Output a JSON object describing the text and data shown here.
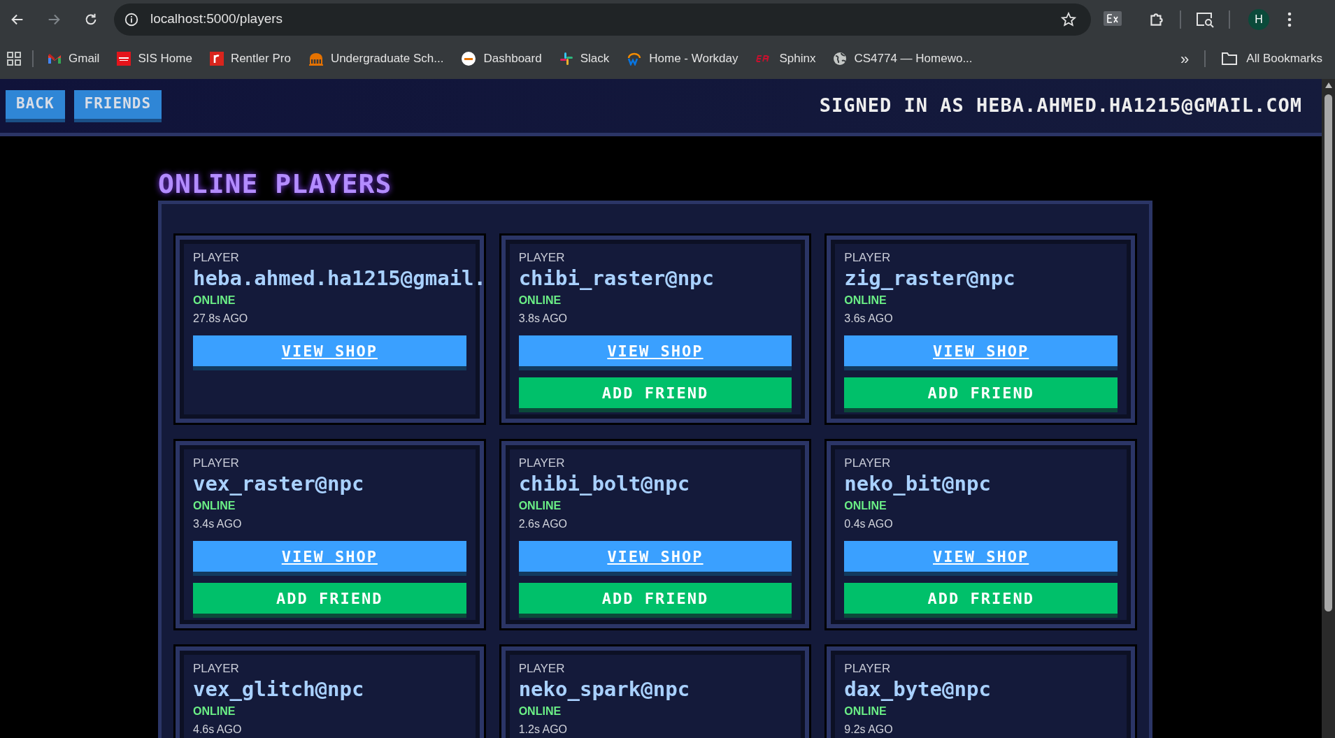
{
  "browser": {
    "url": "localhost:5000/players",
    "profile_initial": "H",
    "bookmarks": [
      {
        "label": "Gmail",
        "kind": "gmail"
      },
      {
        "label": "SIS Home",
        "kind": "oracle"
      },
      {
        "label": "Rentler Pro",
        "kind": "rentler"
      },
      {
        "label": "Undergraduate Sch...",
        "kind": "building"
      },
      {
        "label": "Dashboard",
        "kind": "uva"
      },
      {
        "label": "Slack",
        "kind": "slack"
      },
      {
        "label": "Home - Workday",
        "kind": "workday"
      },
      {
        "label": "Sphinx",
        "kind": "epic"
      },
      {
        "label": "CS4774 — Homewo...",
        "kind": "globe"
      }
    ],
    "more_bookmarks": "»",
    "all_bookmarks": "All Bookmarks"
  },
  "header": {
    "buttons": [
      "BACK",
      "FRIENDS"
    ],
    "signed_in": "SIGNED IN AS HEBA.AHMED.HA1215@GMAIL.COM"
  },
  "title": "ONLINE PLAYERS",
  "players": [
    {
      "label": "PLAYER",
      "name": "heba.ahmed.ha1215@gmail.",
      "status": "ONLINE",
      "ago": "27.8s AGO",
      "view_shop": "VIEW SHOP"
    },
    {
      "label": "PLAYER",
      "name": "chibi_raster@npc",
      "status": "ONLINE",
      "ago": "3.8s AGO",
      "view_shop": "VIEW SHOP",
      "add_friend": "ADD FRIEND"
    },
    {
      "label": "PLAYER",
      "name": "zig_raster@npc",
      "status": "ONLINE",
      "ago": "3.6s AGO",
      "view_shop": "VIEW SHOP",
      "add_friend": "ADD FRIEND"
    },
    {
      "label": "PLAYER",
      "name": "vex_raster@npc",
      "status": "ONLINE",
      "ago": "3.4s AGO",
      "view_shop": "VIEW SHOP",
      "add_friend": "ADD FRIEND"
    },
    {
      "label": "PLAYER",
      "name": "chibi_bolt@npc",
      "status": "ONLINE",
      "ago": "2.6s AGO",
      "view_shop": "VIEW SHOP",
      "add_friend": "ADD FRIEND"
    },
    {
      "label": "PLAYER",
      "name": "neko_bit@npc",
      "status": "ONLINE",
      "ago": "0.4s AGO",
      "view_shop": "VIEW SHOP",
      "add_friend": "ADD FRIEND"
    },
    {
      "label": "PLAYER",
      "name": "vex_glitch@npc",
      "status": "ONLINE",
      "ago": "4.6s AGO"
    },
    {
      "label": "PLAYER",
      "name": "neko_spark@npc",
      "status": "ONLINE",
      "ago": "1.2s AGO"
    },
    {
      "label": "PLAYER",
      "name": "dax_byte@npc",
      "status": "ONLINE",
      "ago": "9.2s AGO"
    }
  ]
}
